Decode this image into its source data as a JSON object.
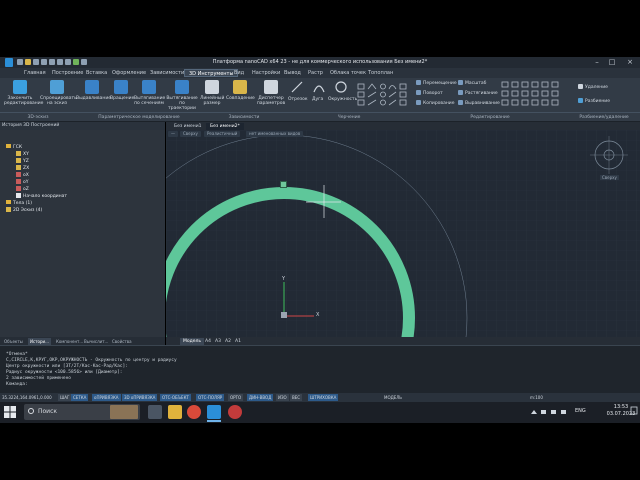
{
  "window": {
    "title": "Платформа nanoCAD x64 23 - не для коммерческого использования Без имени2*"
  },
  "menu_tabs": [
    "Главная",
    "Построение",
    "Вставка",
    "Оформление",
    "Зависимости",
    "3D Инструменты",
    "Вид",
    "Настройки",
    "Вывод",
    "Растр",
    "Облака точек",
    "Топоплан"
  ],
  "active_tab_index": 5,
  "ribbon": {
    "buttons": [
      {
        "label": "Закончить редактирование",
        "color": "#3ba0e0"
      },
      {
        "label": "Спроецировать на эскиз",
        "color": "#4f9fd6"
      },
      {
        "label": "Выдавливание",
        "color": "#3a82c8"
      },
      {
        "label": "Вращение",
        "color": "#3a82c8"
      },
      {
        "label": "Вытягивание по сечениям",
        "color": "#3a82c8"
      },
      {
        "label": "Вытягивание по траектории",
        "color": "#3a82c8"
      },
      {
        "label": "Линейный размер",
        "color": "#cfd6de"
      },
      {
        "label": "Совпадение",
        "color": "#d9b64a"
      },
      {
        "label": "Диспетчер параметров",
        "color": "#cfd6de"
      }
    ],
    "groups": [
      "3D-эскиз",
      "Параметрическое моделирование",
      "Зависимости",
      "Черчение",
      "Редактирование",
      "Разбиение/удаление"
    ],
    "draw_items": [
      "Отрезок",
      "Дуга",
      "Окружность"
    ],
    "edit_items": [
      "Перемещение",
      "Поворот",
      "Копирование",
      "Масштаб",
      "Растягивание",
      "Выравнивание"
    ],
    "split_items": [
      "Удаление",
      "Разбиение"
    ]
  },
  "left_panel": {
    "header": "История 3D Построений",
    "tree": [
      {
        "label": "ГСК",
        "level": 0,
        "kind": "folder"
      },
      {
        "label": "XY",
        "level": 1,
        "kind": "plane"
      },
      {
        "label": "YZ",
        "level": 1,
        "kind": "plane"
      },
      {
        "label": "ZX",
        "level": 1,
        "kind": "plane"
      },
      {
        "label": "oX",
        "level": 1,
        "kind": "axis"
      },
      {
        "label": "oY",
        "level": 1,
        "kind": "axis"
      },
      {
        "label": "oZ",
        "level": 1,
        "kind": "axis"
      },
      {
        "label": "Начало координат",
        "level": 1,
        "kind": "point"
      },
      {
        "label": "Тела (1)",
        "level": 0,
        "kind": "folder"
      },
      {
        "label": "2D Эскиз (4)",
        "level": 0,
        "kind": "sketch"
      }
    ],
    "bottom_tabs": [
      "Объекты",
      "Истори...",
      "Компонент...",
      "Вычислит...",
      "Свойства"
    ],
    "active_bottom_tab": 1
  },
  "documents": {
    "tabs": [
      "Без имени1",
      "Без имени2*"
    ],
    "active": 1,
    "view_crumbs": [
      "Сверху",
      "Реалистичный",
      "нет именованных видов"
    ]
  },
  "viewport": {
    "compass_label": "Сверху",
    "ring_color": "#5ec79a",
    "axis_y_label": "Y",
    "axis_x_label": "X"
  },
  "layouts": {
    "tabs": [
      "Модель",
      "A4",
      "A3",
      "A2",
      "A1"
    ],
    "active": 0
  },
  "command_history": [
    "*Отмена*",
    "C,CIRCLE,K,КРУГ,ОКР,ОКРУЖНОСТЬ - Окружность по центру и радиусу",
    "Центр окружности или [3Т/2Т/Кас-Кас-Рад/Кас]:",
    "Радиус окружности <100.5856> или [Диаметр]:",
    "2 зависимостей применено",
    "Команда:"
  ],
  "status": {
    "coords": "35.3224,164.0961,0.000",
    "toggles": [
      {
        "label": "ШАГ",
        "on": false
      },
      {
        "label": "СЕТКА",
        "on": true
      },
      {
        "label": "оПРИВЯЗКА",
        "on": true
      },
      {
        "label": "3D оПРИВЯЗКА",
        "on": true
      },
      {
        "label": "ОТС-ОБЪЕКТ",
        "on": true
      },
      {
        "label": "ОТС-ПОЛЯР",
        "on": true
      },
      {
        "label": "ОРТО",
        "on": false
      },
      {
        "label": "ДИН-ВВОД",
        "on": true
      },
      {
        "label": "ИЗО",
        "on": false
      },
      {
        "label": "ВЕС",
        "on": false
      },
      {
        "label": "ШТРИХОВКА",
        "on": true
      }
    ],
    "model_label": "МОДЕЛЬ",
    "scale": "m:100"
  },
  "taskbar": {
    "search_placeholder": "Поиск",
    "language": "ENG",
    "time": "13:53",
    "date": "03.07.2023"
  }
}
